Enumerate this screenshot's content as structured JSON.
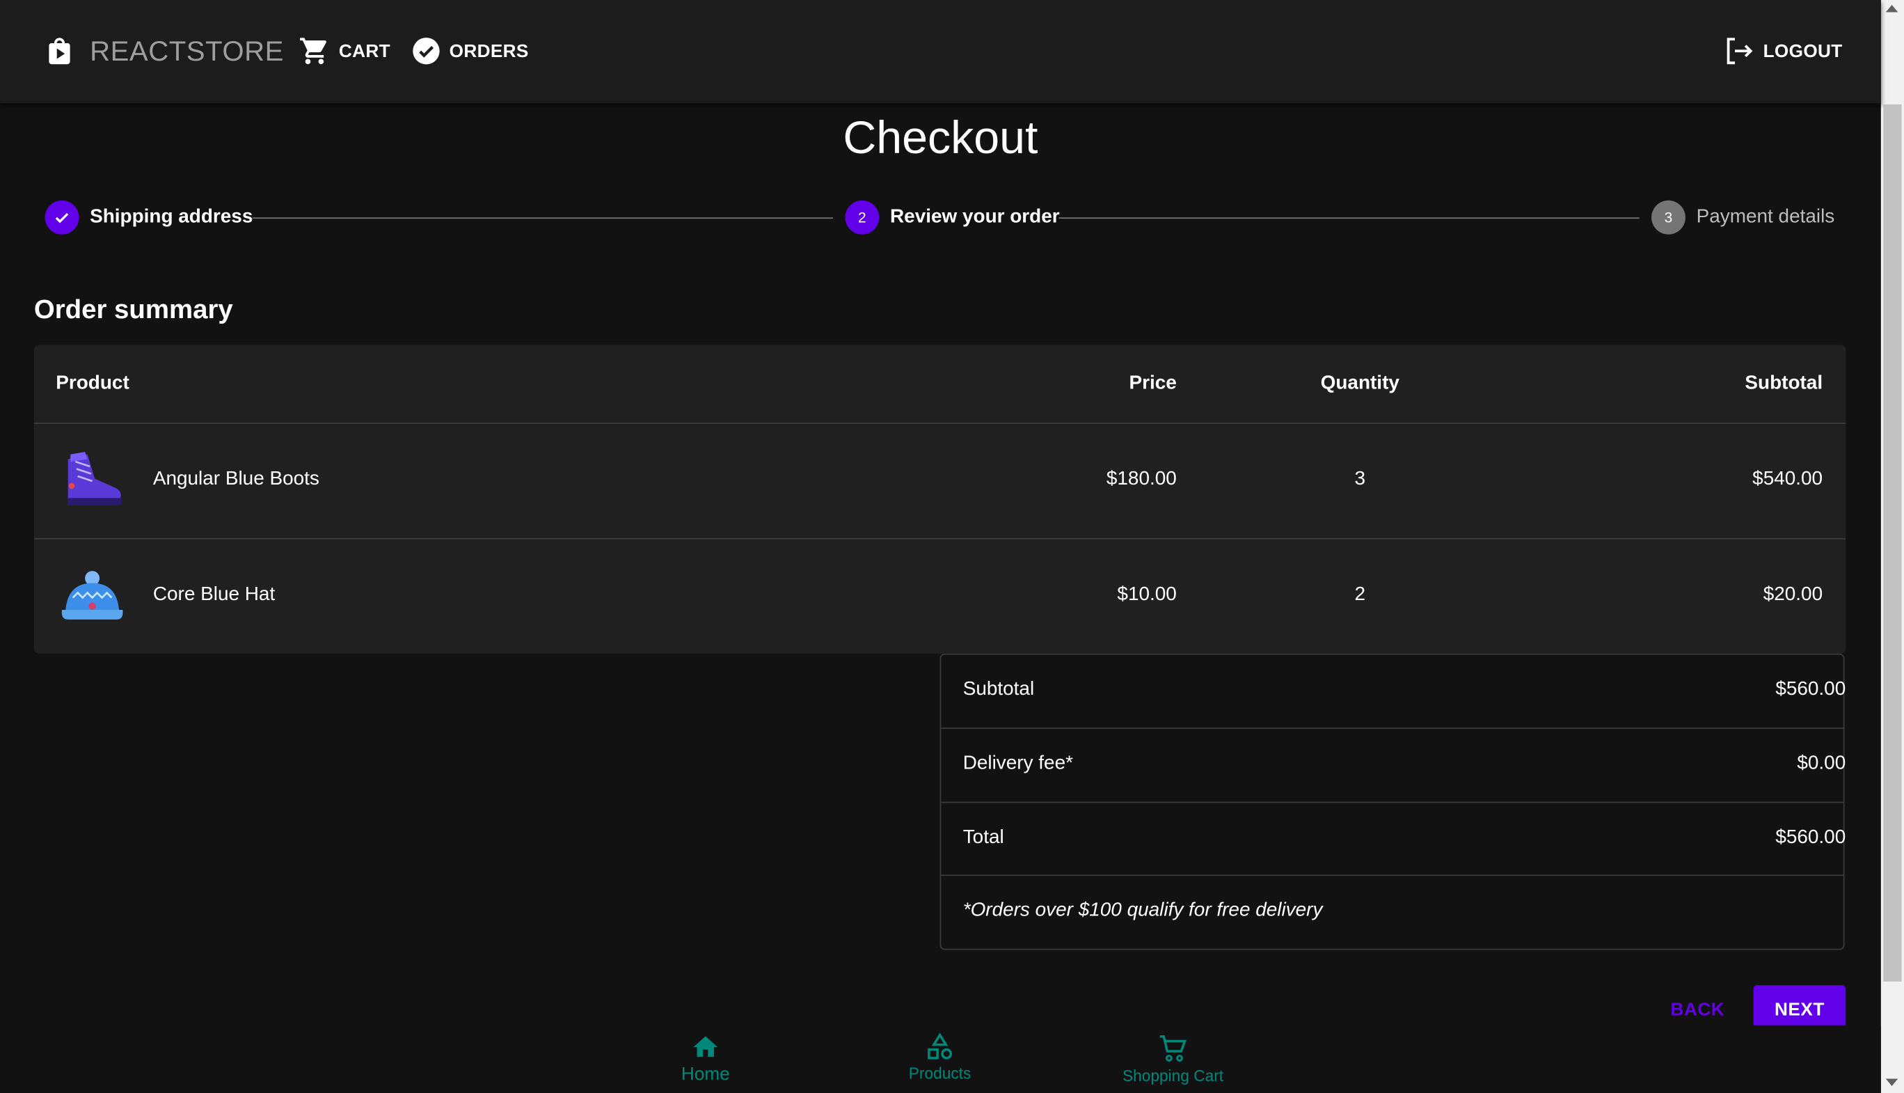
{
  "appbar": {
    "brand": "REACTSTORE",
    "cart_label": "CART",
    "orders_label": "ORDERS",
    "logout_label": "LOGOUT"
  },
  "page": {
    "title": "Checkout"
  },
  "stepper": {
    "steps": [
      {
        "label": "Shipping address",
        "state": "completed"
      },
      {
        "label": "Review your order",
        "number": "2",
        "state": "active"
      },
      {
        "label": "Payment details",
        "number": "3",
        "state": "inactive"
      }
    ]
  },
  "summary": {
    "heading": "Order summary",
    "columns": [
      "Product",
      "Price",
      "Quantity",
      "Subtotal"
    ],
    "rows": [
      {
        "product": "Angular Blue Boots",
        "image": "boots-icon",
        "price": "$180.00",
        "quantity": "3",
        "subtotal": "$540.00"
      },
      {
        "product": "Core Blue Hat",
        "image": "hat-icon",
        "price": "$10.00",
        "quantity": "2",
        "subtotal": "$20.00"
      }
    ]
  },
  "totals": {
    "subtotal_label": "Subtotal",
    "subtotal_value": "$560.00",
    "delivery_label": "Delivery fee*",
    "delivery_value": "$0.00",
    "total_label": "Total",
    "total_value": "$560.00",
    "note": "*Orders over $100 qualify for free delivery"
  },
  "actions": {
    "back_label": "BACK",
    "next_label": "NEXT"
  },
  "bottom_nav": {
    "items": [
      {
        "label": "Home",
        "icon": "home-icon"
      },
      {
        "label": "Products",
        "icon": "shapes-icon"
      },
      {
        "label": "Shopping Cart",
        "icon": "cart-icon"
      }
    ]
  },
  "colors": {
    "accent": "#6200ea",
    "bottom_nav": "#00897b",
    "background": "#121212"
  }
}
